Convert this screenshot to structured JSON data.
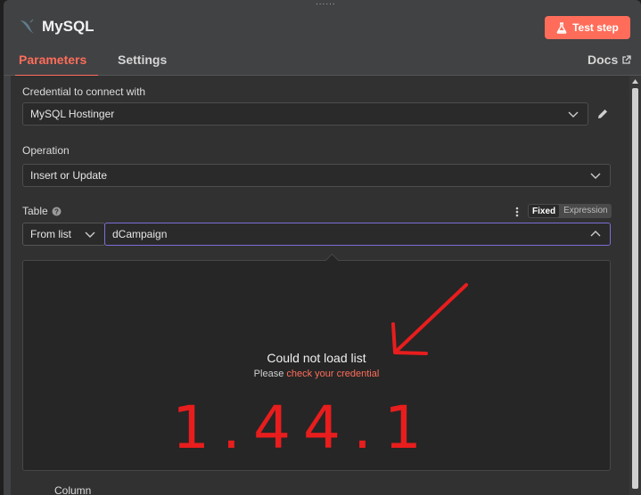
{
  "node": {
    "title": "MySQL",
    "test_button": "Test step"
  },
  "tabs": [
    {
      "label": "Parameters"
    },
    {
      "label": "Settings"
    }
  ],
  "docs": {
    "label": "Docs"
  },
  "credential": {
    "label": "Credential to connect with",
    "value": "MySQL Hostinger"
  },
  "operation": {
    "label": "Operation",
    "value": "Insert or Update"
  },
  "table": {
    "label": "Table",
    "mode_fixed": "Fixed",
    "mode_expression": "Expression",
    "source": "From list",
    "value": "dCampaign"
  },
  "dropdown": {
    "error_title": "Could not load list",
    "error_prefix": "Please ",
    "error_link": "check your credential"
  },
  "column": {
    "label": "Column"
  },
  "annotation": {
    "text": "1.44.1",
    "color": "#e81d1d"
  },
  "colors": {
    "accent": "#ff6d5a"
  }
}
